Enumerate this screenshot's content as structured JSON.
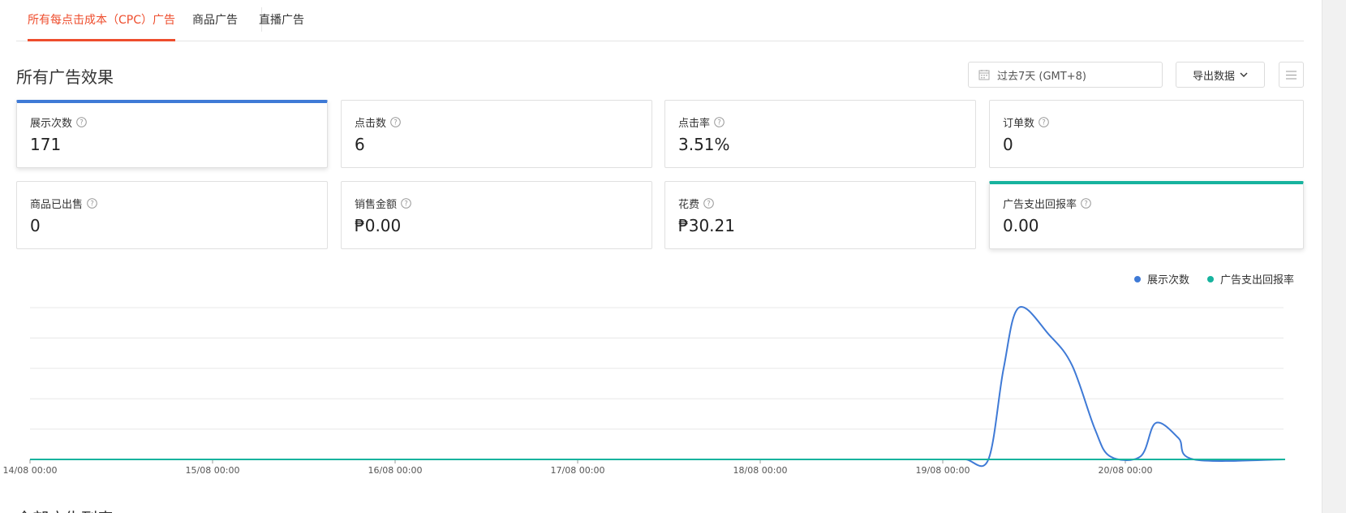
{
  "tabs": [
    {
      "label": "所有每点击成本（CPC）广告",
      "active": true
    },
    {
      "label": "商品广告",
      "active": false
    },
    {
      "label": "直播广告",
      "active": false
    }
  ],
  "section_title": "所有广告效果",
  "date_range": "过去7天 (GMT+8)",
  "export_label": "导出数据",
  "metrics": [
    {
      "label": "展示次数",
      "value": "171"
    },
    {
      "label": "点击数",
      "value": "6"
    },
    {
      "label": "点击率",
      "value": "3.51%"
    },
    {
      "label": "订单数",
      "value": "0"
    },
    {
      "label": "商品已出售",
      "value": "0"
    },
    {
      "label": "销售金额",
      "value": "₱0.00"
    },
    {
      "label": "花费",
      "value": "₱30.21"
    },
    {
      "label": "广告支出回报率",
      "value": "0.00"
    }
  ],
  "colors": {
    "accent": "#ee4d2d",
    "impressions": "#3f7ad6",
    "roas": "#17b39e"
  },
  "chart_data": {
    "type": "line",
    "x": [
      "14/08 00:00",
      "15/08 00:00",
      "16/08 00:00",
      "17/08 00:00",
      "18/08 00:00",
      "19/08 00:00",
      "20/08 00:00"
    ],
    "series": [
      {
        "name": "展示次数",
        "points": [
          [
            "14/08 00:00",
            0
          ],
          [
            "19/08 00:00",
            0
          ],
          [
            "19/08 03:00",
            0
          ],
          [
            "19/08 06:00",
            0
          ],
          [
            "19/08 08:00",
            60
          ],
          [
            "19/08 10:00",
            100
          ],
          [
            "19/08 14:00",
            82
          ],
          [
            "19/08 17:00",
            62
          ],
          [
            "19/08 20:00",
            20
          ],
          [
            "19/08 22:00",
            2
          ],
          [
            "20/08 02:00",
            2
          ],
          [
            "20/08 04:00",
            24
          ],
          [
            "20/08 07:00",
            14
          ],
          [
            "20/08 09:00",
            0
          ],
          [
            "20/08 21:00",
            0
          ]
        ]
      },
      {
        "name": "广告支出回报率",
        "points": [
          [
            "14/08 00:00",
            0
          ],
          [
            "20/08 21:00",
            0
          ]
        ]
      }
    ],
    "ylim": [
      0,
      100
    ],
    "grid": true,
    "legend": "top-right"
  },
  "bottom_title": "全部广告列表"
}
